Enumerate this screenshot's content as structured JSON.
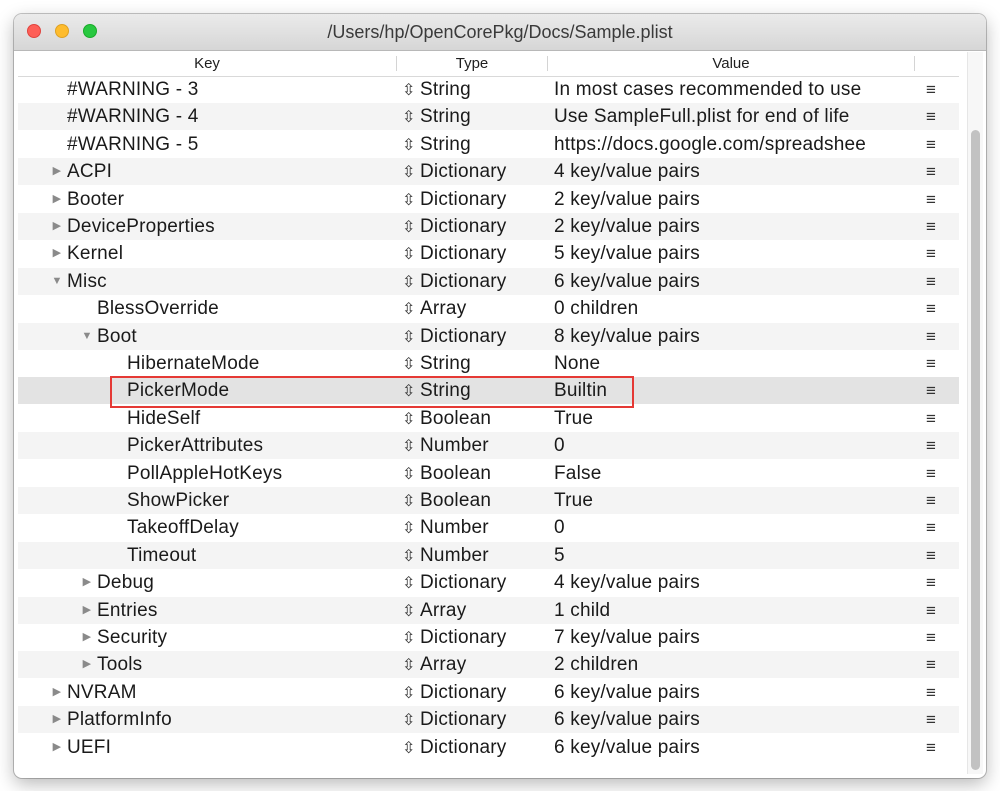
{
  "window": {
    "title": "/Users/hp/OpenCorePkg/Docs/Sample.plist"
  },
  "header": {
    "key": "Key",
    "type": "Type",
    "value": "Value"
  },
  "icons": {
    "expanded": "▼",
    "collapsed": "▶",
    "stepper": "⇳",
    "menu": "≡"
  },
  "colors": {
    "highlight_border": "#e53935",
    "close": "#fe5f57",
    "minimize": "#febc2e",
    "maximize": "#28c840"
  },
  "rows": [
    {
      "key": "#WARNING - 3",
      "type": "String",
      "value": "In most cases recommended to use",
      "indent": 0,
      "disclosure": "none"
    },
    {
      "key": "#WARNING - 4",
      "type": "String",
      "value": "Use SampleFull.plist for end of life",
      "indent": 0,
      "disclosure": "none"
    },
    {
      "key": "#WARNING - 5",
      "type": "String",
      "value": "https://docs.google.com/spreadshee",
      "indent": 0,
      "disclosure": "none"
    },
    {
      "key": "ACPI",
      "type": "Dictionary",
      "value": "4 key/value pairs",
      "indent": 0,
      "disclosure": "collapsed"
    },
    {
      "key": "Booter",
      "type": "Dictionary",
      "value": "2 key/value pairs",
      "indent": 0,
      "disclosure": "collapsed"
    },
    {
      "key": "DeviceProperties",
      "type": "Dictionary",
      "value": "2 key/value pairs",
      "indent": 0,
      "disclosure": "collapsed"
    },
    {
      "key": "Kernel",
      "type": "Dictionary",
      "value": "5 key/value pairs",
      "indent": 0,
      "disclosure": "collapsed"
    },
    {
      "key": "Misc",
      "type": "Dictionary",
      "value": "6 key/value pairs",
      "indent": 0,
      "disclosure": "expanded"
    },
    {
      "key": "BlessOverride",
      "type": "Array",
      "value": "0 children",
      "indent": 1,
      "disclosure": "none"
    },
    {
      "key": "Boot",
      "type": "Dictionary",
      "value": "8 key/value pairs",
      "indent": 1,
      "disclosure": "expanded"
    },
    {
      "key": "HibernateMode",
      "type": "String",
      "value": "None",
      "indent": 2,
      "disclosure": "none"
    },
    {
      "key": "PickerMode",
      "type": "String",
      "value": "Builtin",
      "indent": 2,
      "disclosure": "none",
      "selected": true
    },
    {
      "key": "HideSelf",
      "type": "Boolean",
      "value": "True",
      "indent": 2,
      "disclosure": "none"
    },
    {
      "key": "PickerAttributes",
      "type": "Number",
      "value": "0",
      "indent": 2,
      "disclosure": "none"
    },
    {
      "key": "PollAppleHotKeys",
      "type": "Boolean",
      "value": "False",
      "indent": 2,
      "disclosure": "none"
    },
    {
      "key": "ShowPicker",
      "type": "Boolean",
      "value": "True",
      "indent": 2,
      "disclosure": "none"
    },
    {
      "key": "TakeoffDelay",
      "type": "Number",
      "value": "0",
      "indent": 2,
      "disclosure": "none"
    },
    {
      "key": "Timeout",
      "type": "Number",
      "value": "5",
      "indent": 2,
      "disclosure": "none"
    },
    {
      "key": "Debug",
      "type": "Dictionary",
      "value": "4 key/value pairs",
      "indent": 1,
      "disclosure": "collapsed"
    },
    {
      "key": "Entries",
      "type": "Array",
      "value": "1 child",
      "indent": 1,
      "disclosure": "collapsed"
    },
    {
      "key": "Security",
      "type": "Dictionary",
      "value": "7 key/value pairs",
      "indent": 1,
      "disclosure": "collapsed"
    },
    {
      "key": "Tools",
      "type": "Array",
      "value": "2 children",
      "indent": 1,
      "disclosure": "collapsed"
    },
    {
      "key": "NVRAM",
      "type": "Dictionary",
      "value": "6 key/value pairs",
      "indent": 0,
      "disclosure": "collapsed"
    },
    {
      "key": "PlatformInfo",
      "type": "Dictionary",
      "value": "6 key/value pairs",
      "indent": 0,
      "disclosure": "collapsed"
    },
    {
      "key": "UEFI",
      "type": "Dictionary",
      "value": "6 key/value pairs",
      "indent": 0,
      "disclosure": "collapsed"
    }
  ]
}
